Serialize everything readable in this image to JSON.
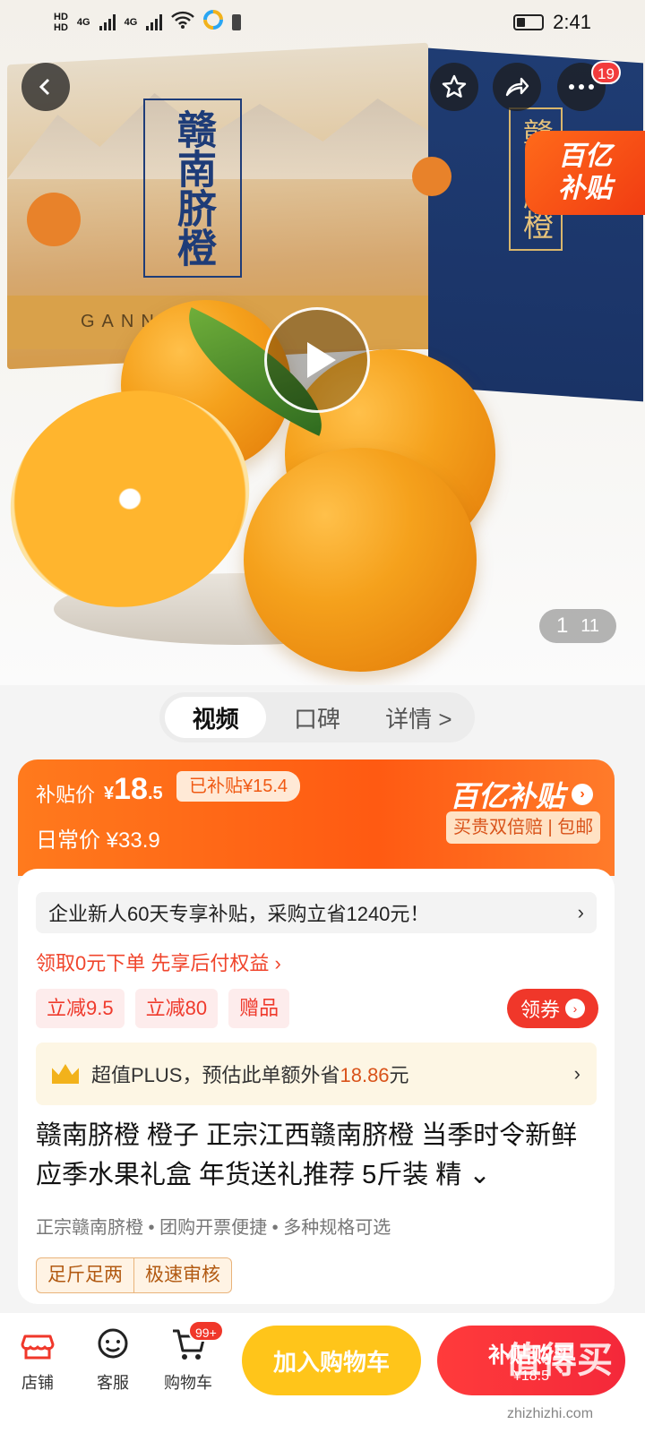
{
  "status_bar": {
    "network_left": "HD 4G",
    "time": "2:41"
  },
  "hero": {
    "box_text": "赣南脐橙",
    "box_side_text": "赣南脐橙",
    "box_brand": "GANN",
    "subsidy_badge": [
      "百亿",
      "补贴"
    ],
    "image_index": "1",
    "image_total": "11",
    "more_badge": "19"
  },
  "tabs": [
    "视频",
    "口碑",
    "详情 >"
  ],
  "price": {
    "subsidy_label": "补贴价",
    "currency": "¥",
    "price_int": "18",
    "price_dec": ".5",
    "already_subsidized": "已补贴¥15.4",
    "regular_label": "日常价",
    "regular_price": "¥33.9",
    "brand": "百亿补贴",
    "guarantee": "买贵双倍赔 | 包邮"
  },
  "promo": {
    "enterprise": "企业新人60天专享补贴，采购立省1240元！",
    "paylater": "领取0元下单 先享后付权益 ›",
    "chips": [
      "立减9.5",
      "立减80",
      "赠品"
    ],
    "coupon": "领券",
    "plus_prefix": "超值PLUS，预估此单额外省",
    "plus_amount": "18.86",
    "plus_suffix": "元"
  },
  "product": {
    "title": "赣南脐橙 橙子 正宗江西赣南脐橙 当季时令新鲜应季水果礼盒 年货送礼推荐 5斤装 精 ⌄",
    "features": "正宗赣南脐橙 • 团购开票便捷 • 多种规格可选",
    "tags": [
      "足斤足两",
      "极速审核"
    ]
  },
  "bottom_bar": {
    "shop": "店铺",
    "service": "客服",
    "cart": "购物车",
    "cart_badge": "99+",
    "add_to_cart": "加入购物车",
    "buy_label": "补贴购买",
    "buy_price": "¥18.5"
  },
  "watermark": {
    "main": "值得买",
    "sub": "zhizhizhi.com"
  },
  "colors": {
    "accent_orange": "#ff5a12",
    "accent_red": "#f0372a",
    "cart_yellow": "#ffc51a"
  }
}
